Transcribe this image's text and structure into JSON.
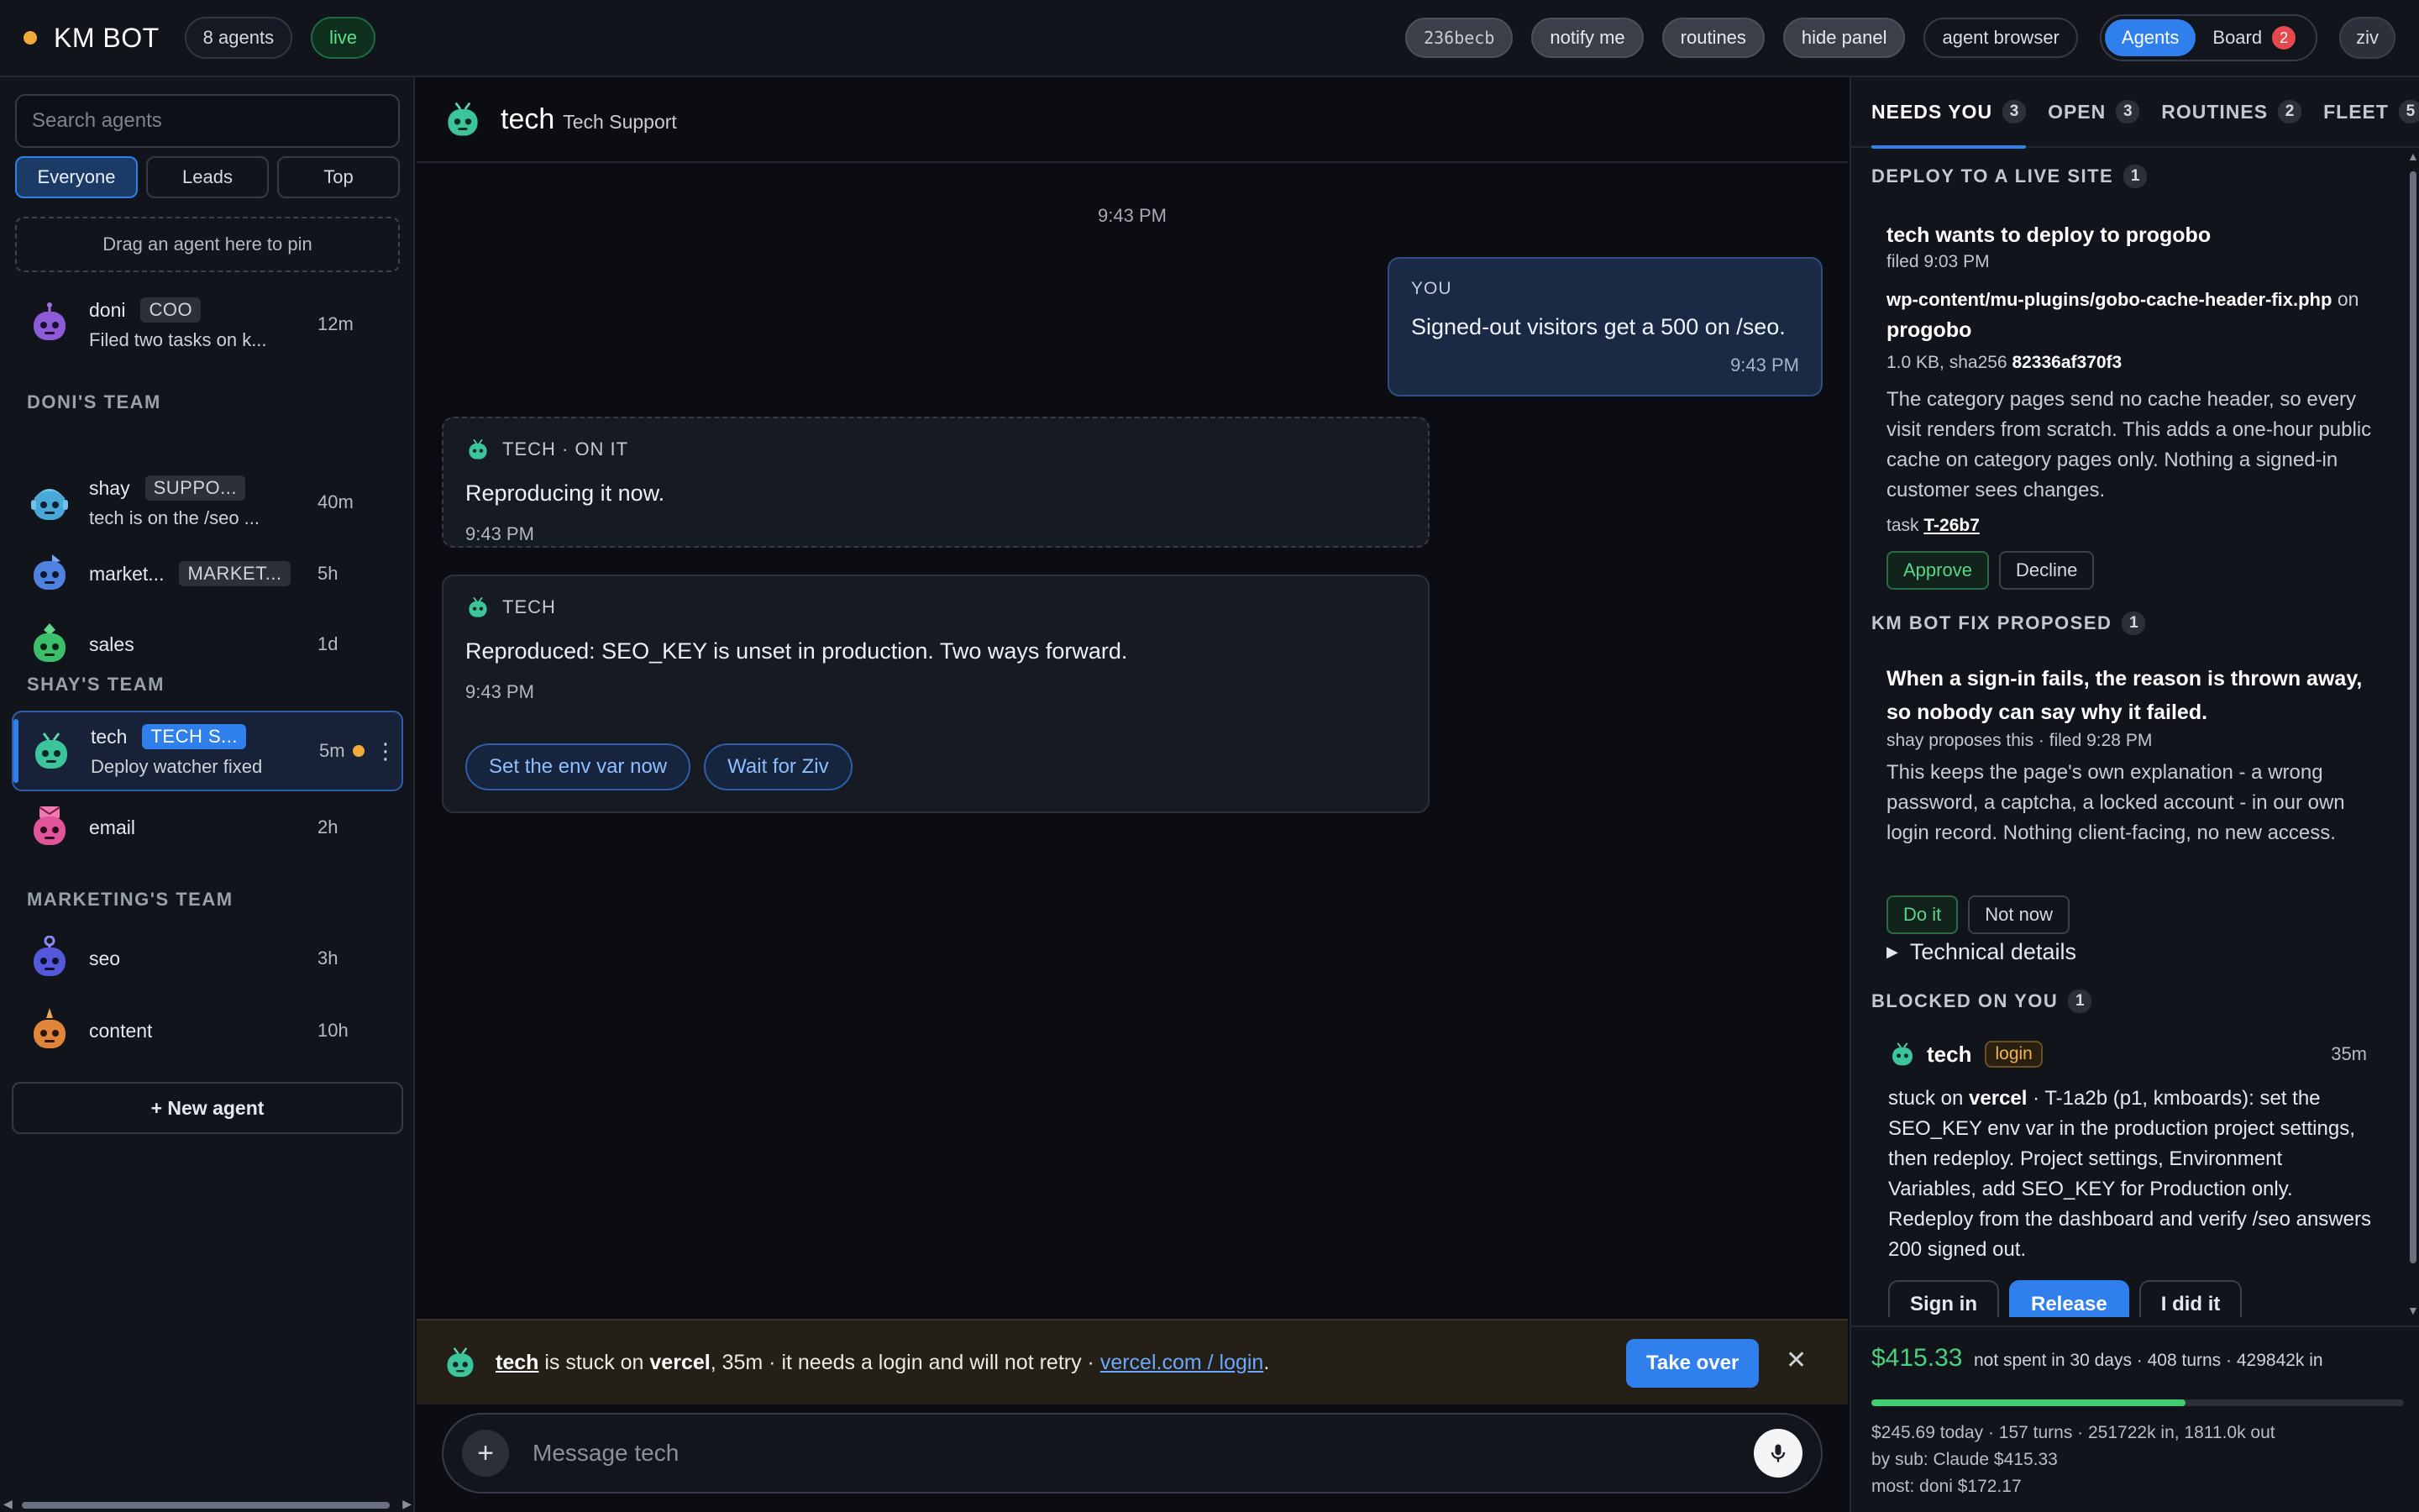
{
  "topbar": {
    "brand": "KM BOT",
    "agents_count": "8 agents",
    "live": "live",
    "commit": "236becb",
    "notify": "notify me",
    "routines": "routines",
    "hide_panel": "hide panel",
    "agent_browser": "agent browser",
    "view_agents": "Agents",
    "view_board": "Board",
    "board_badge": "2",
    "user": "ziv"
  },
  "sidebar": {
    "search_placeholder": "Search agents",
    "filters": [
      "Everyone",
      "Leads",
      "Top"
    ],
    "pin_zone": "Drag an agent here to pin",
    "pinned": {
      "name": "doni",
      "role": "COO",
      "preview": "Filed two tasks on k...",
      "time": "12m"
    },
    "teams": [
      {
        "title": "DONI'S TEAM",
        "agents": [
          {
            "name": "shay",
            "role": "SUPPO...",
            "preview": "tech is on the /seo ...",
            "time": "40m"
          },
          {
            "name": "market...",
            "role": "MARKET...",
            "preview": "",
            "time": "5h"
          },
          {
            "name": "sales",
            "role": "",
            "preview": "",
            "time": "1d"
          }
        ]
      },
      {
        "title": "SHAY'S TEAM",
        "agents": [
          {
            "name": "tech",
            "role": "TECH S...",
            "preview": "Deploy watcher fixed",
            "time": "5m"
          },
          {
            "name": "email",
            "role": "",
            "preview": "",
            "time": "2h"
          }
        ]
      },
      {
        "title": "MARKETING'S TEAM",
        "agents": [
          {
            "name": "seo",
            "role": "",
            "preview": "",
            "time": "3h"
          },
          {
            "name": "content",
            "role": "",
            "preview": "",
            "time": "10h"
          }
        ]
      }
    ],
    "new_agent": "+ New agent"
  },
  "chat": {
    "title": "tech",
    "subtitle": "Tech Support",
    "day_time": "9:43 PM",
    "you": {
      "label": "YOU",
      "text": "Signed-out visitors get a 500 on /seo.",
      "time": "9:43 PM"
    },
    "m1": {
      "label": "TECH · ON IT",
      "text": "Reproducing it now.",
      "time": "9:43 PM"
    },
    "m2": {
      "label": "TECH",
      "text": "Reproduced: SEO_KEY is unset in production. Two ways forward.",
      "time": "9:43 PM",
      "actions": [
        "Set the env var now",
        "Wait for Ziv"
      ]
    },
    "alert": {
      "agent": "tech",
      "stuck_text": " is stuck on ",
      "service": "vercel",
      "rest": ", 35m · it needs a login and will not retry · ",
      "link": "vercel.com / login",
      "end": ".",
      "take_over": "Take over",
      "close": "✕"
    },
    "composer": {
      "plus": "+",
      "placeholder": "Message tech"
    }
  },
  "panel": {
    "tabs": [
      {
        "label": "NEEDS YOU",
        "count": "3"
      },
      {
        "label": "OPEN",
        "count": "3"
      },
      {
        "label": "ROUTINES",
        "count": "2"
      },
      {
        "label": "FLEET",
        "count": "5"
      }
    ],
    "deploy": {
      "section": "DEPLOY TO A LIVE SITE",
      "count": "1",
      "title": "tech wants to deploy to progobo",
      "filed": "filed 9:03 PM",
      "file": "wp-content/mu-plugins/gobo-cache-header-fix.php",
      "on": " on ",
      "site": "progobo",
      "size": "1.0 KB, sha256 ",
      "sha": "82336af370f3",
      "body": "The category pages send no cache header, so every visit renders from scratch. This adds a one-hour public cache on category pages only. Nothing a signed-in customer sees changes.",
      "task_label": "task ",
      "task_id": "T-26b7",
      "approve": "Approve",
      "decline": "Decline"
    },
    "fix": {
      "section": "KM BOT FIX PROPOSED",
      "count": "1",
      "title": "When a sign-in fails, the reason is thrown away, so nobody can say why it failed.",
      "meta": "shay proposes this · filed 9:28 PM",
      "body": "This keeps the page's own explanation - a wrong password, a captcha, a locked account - in our own login record. Nothing client-facing, no new access.",
      "do_it": "Do it",
      "not_now": "Not now",
      "details": "Technical details"
    },
    "blocked": {
      "section": "BLOCKED ON YOU",
      "count": "1",
      "agent": "tech",
      "tag": "login",
      "time": "35m",
      "prefix": "stuck on ",
      "service": "vercel",
      "text": " · T-1a2b (p1, kmboards): set the SEO_KEY env var in the production project settings, then redeploy. Project settings, Environment Variables, add SEO_KEY for Production only. Redeploy from the dashboard and verify /seo answers 200 signed out.",
      "sign_in": "Sign in",
      "release": "Release",
      "i_did_it": "I did it"
    },
    "spend": {
      "amount": "$415.33",
      "desc": "not spent in 30 days · 408 turns · 429842k in",
      "progress": 0.59,
      "today": "$245.69 today · 157 turns · 251722k in, 1811.0k out",
      "by_sub": "by sub: Claude $415.33",
      "most": "most: doni $172.17"
    }
  },
  "colors": {
    "accent": "#2f80ed",
    "live_green": "#5be08d",
    "spend_green": "#49d17d",
    "status_dot": "#f2a93b",
    "alert_bg": "#241f17",
    "badge_red": "#e5484d"
  },
  "icons": {
    "robot": "robot-avatar-icon",
    "mic": "microphone-icon",
    "plus": "plus-icon",
    "close": "close-icon",
    "kebab": "kebab-menu-icon",
    "disclosure": "triangle-right-icon"
  }
}
